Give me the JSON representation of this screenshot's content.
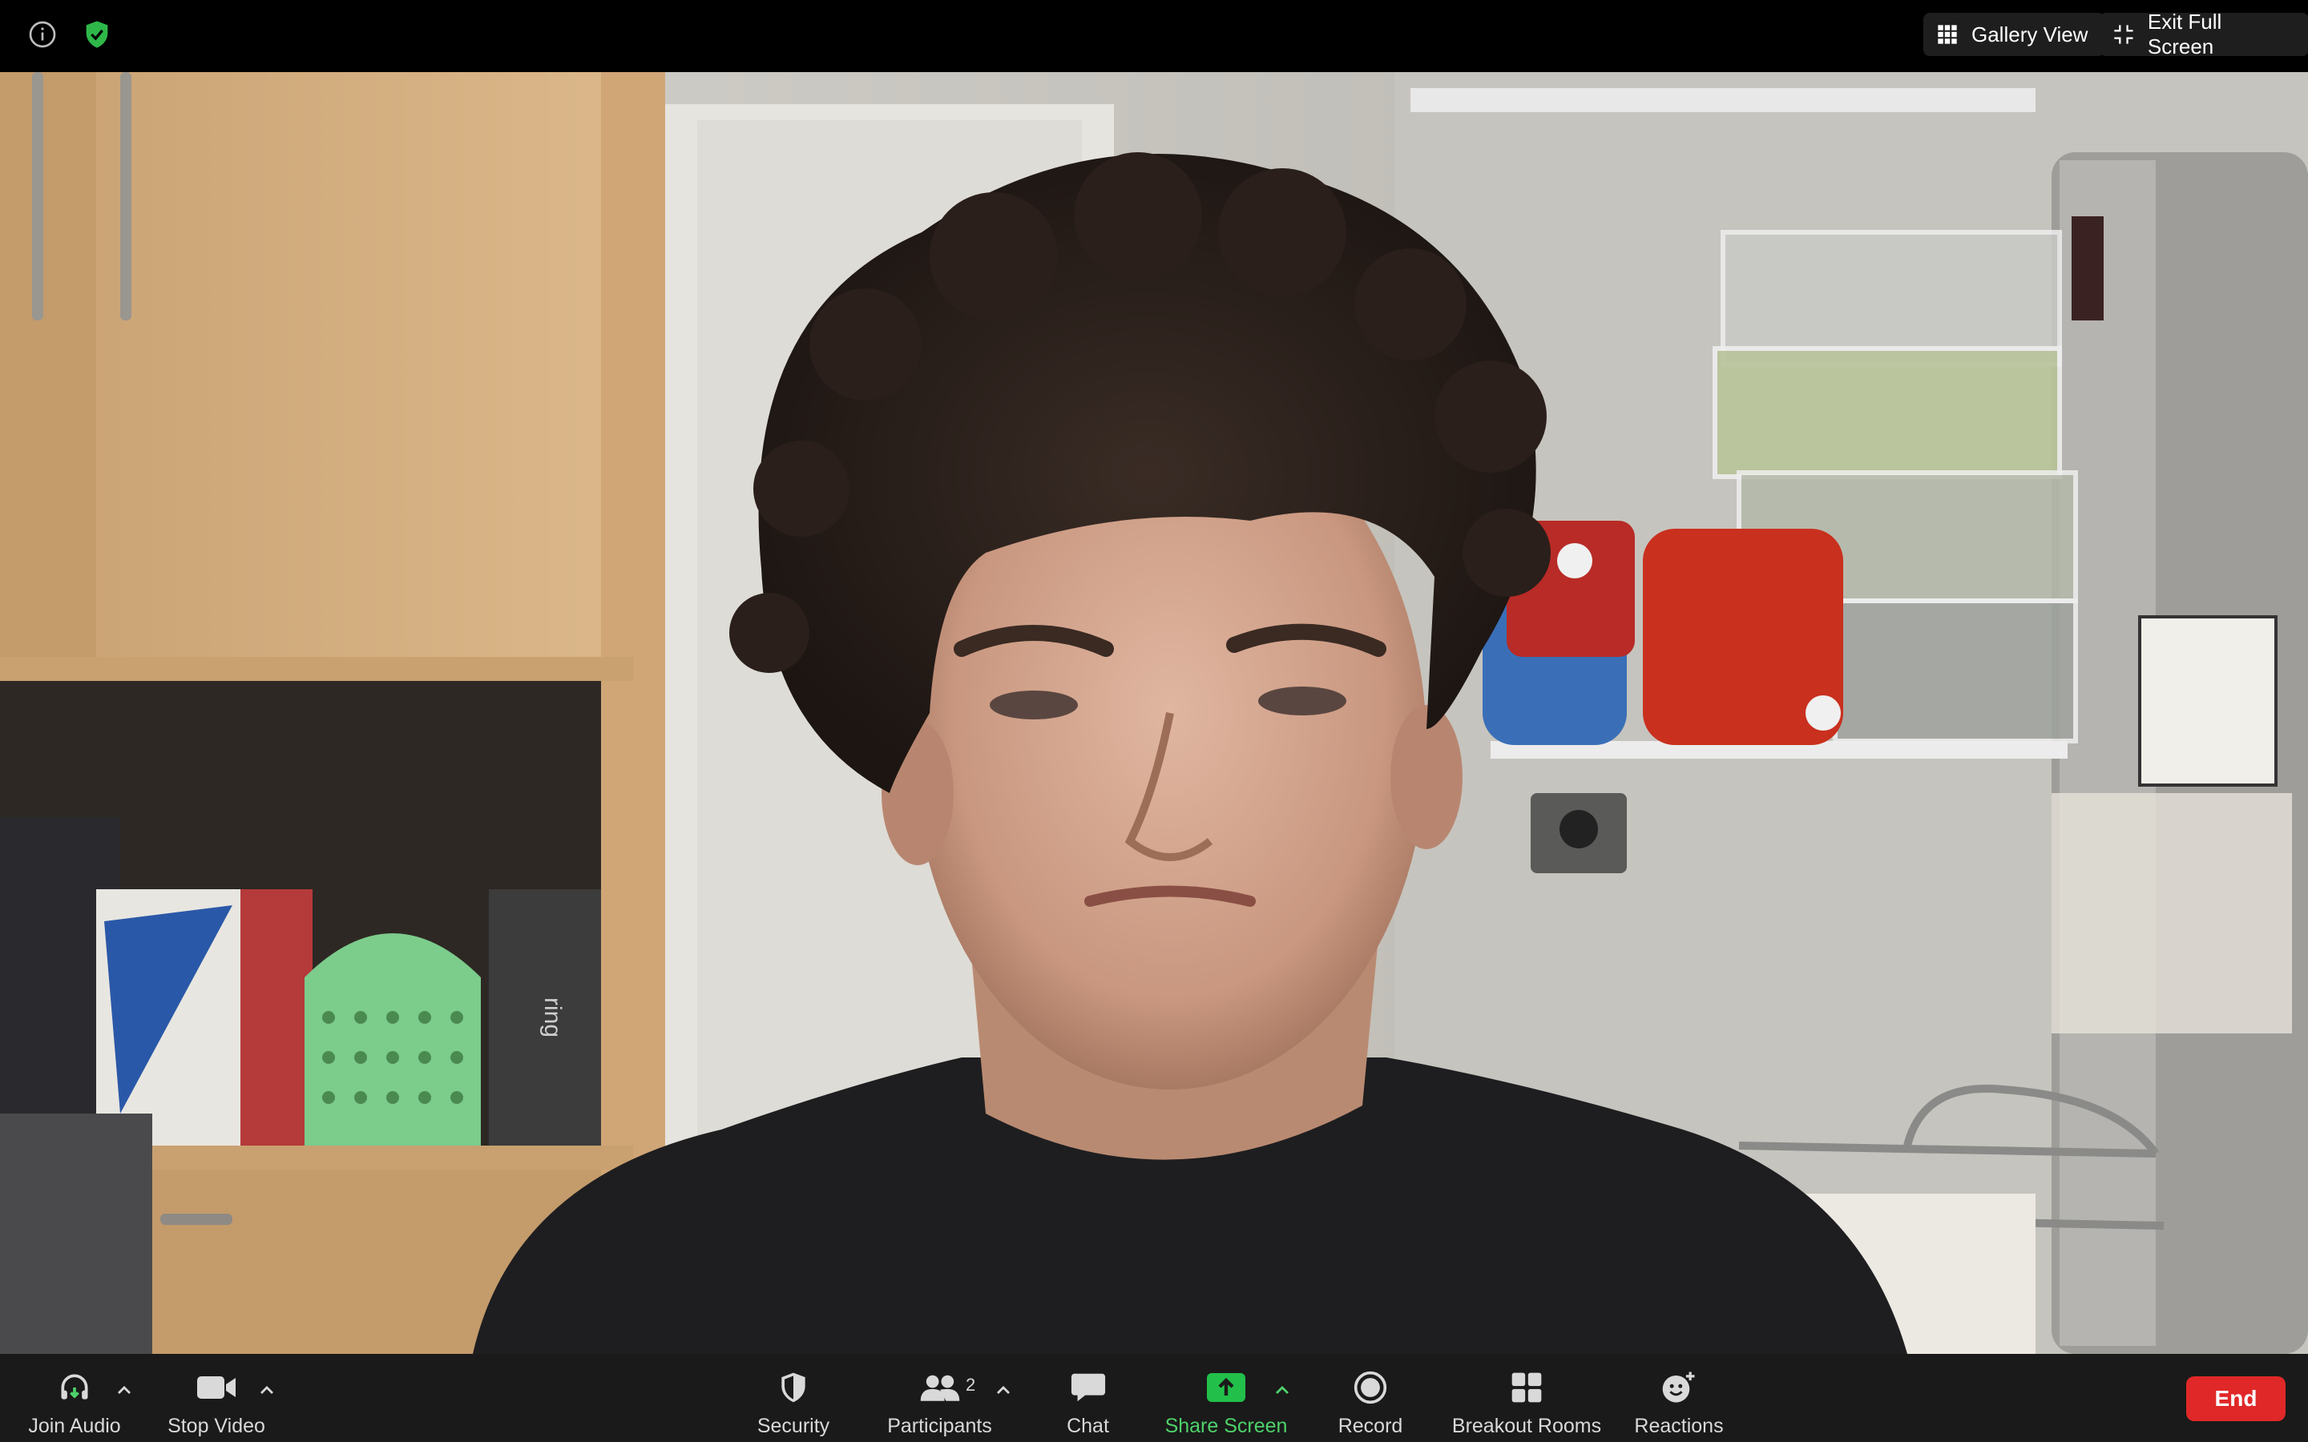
{
  "top_bar": {
    "info_icon": "info-circle-icon",
    "security_icon": "shield-check-icon",
    "gallery_view_label": "Gallery View",
    "exit_full_screen_label": "Exit Full Screen"
  },
  "video": {
    "participant_name": "",
    "device_label": "ring"
  },
  "toolbar": {
    "join_audio_label": "Join Audio",
    "stop_video_label": "Stop Video",
    "security_label": "Security",
    "participants_label": "Participants",
    "participants_count": "2",
    "chat_label": "Chat",
    "share_screen_label": "Share Screen",
    "record_label": "Record",
    "breakout_rooms_label": "Breakout Rooms",
    "reactions_label": "Reactions",
    "end_label": "End"
  },
  "colors": {
    "accent_green": "#4ed26a",
    "share_green": "#22c04a",
    "end_red": "#e02828",
    "toolbar_bg": "#1a1a1a"
  }
}
